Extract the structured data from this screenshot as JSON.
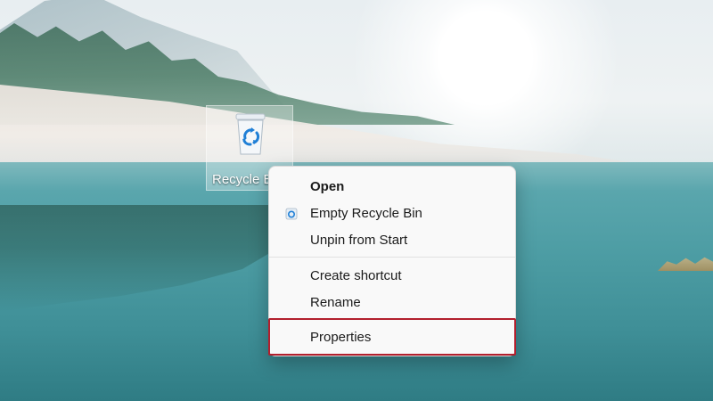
{
  "desktop": {
    "icon": {
      "label": "Recycle B",
      "icon_name": "recycle-bin-icon"
    }
  },
  "context_menu": {
    "items": [
      {
        "label": "Open",
        "bold": true
      },
      {
        "label": "Empty Recycle Bin",
        "icon_name": "recycle-bin-small-icon"
      },
      {
        "label": "Unpin from Start"
      },
      {
        "label": "Create shortcut"
      },
      {
        "label": "Rename"
      },
      {
        "label": "Properties",
        "highlighted": true
      }
    ],
    "highlight_color": "#b21f2d"
  }
}
